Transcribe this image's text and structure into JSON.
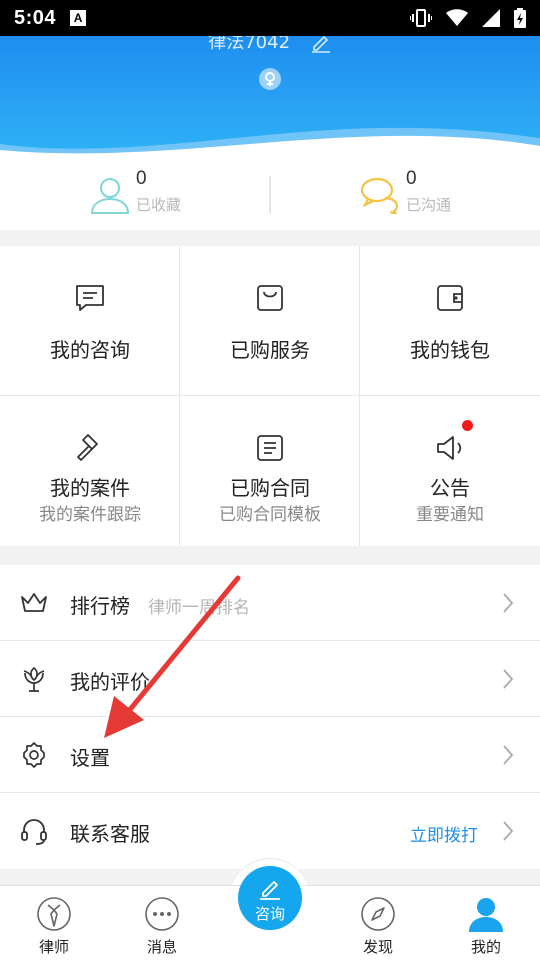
{
  "status_bar": {
    "time": "5:04",
    "notification_letter": "A"
  },
  "profile": {
    "nickname": "律法7042"
  },
  "stats": [
    {
      "count": "0",
      "label": "已收藏"
    },
    {
      "count": "0",
      "label": "已沟通"
    }
  ],
  "grid": [
    {
      "title": "我的咨询",
      "subtitle": ""
    },
    {
      "title": "已购服务",
      "subtitle": ""
    },
    {
      "title": "我的钱包",
      "subtitle": ""
    },
    {
      "title": "我的案件",
      "subtitle": "我的案件跟踪"
    },
    {
      "title": "已购合同",
      "subtitle": "已购合同模板"
    },
    {
      "title": "公告",
      "subtitle": "重要通知"
    }
  ],
  "menu": [
    {
      "title": "排行榜",
      "subtitle": "律师一周排名"
    },
    {
      "title": "我的评价",
      "subtitle": ""
    },
    {
      "title": "设置",
      "subtitle": ""
    },
    {
      "title": "联系客服",
      "action": "立即拨打"
    }
  ],
  "tabbar": {
    "tabs": [
      {
        "label": "律师"
      },
      {
        "label": "消息"
      },
      {
        "label": "发现"
      },
      {
        "label": "我的"
      }
    ],
    "center_label": "咨询"
  },
  "colors": {
    "header_blue": "#1f8ef0",
    "accent_blue": "#1e90e8",
    "badge_red": "#f21b1b",
    "annotation_arrow": "#e53935"
  }
}
